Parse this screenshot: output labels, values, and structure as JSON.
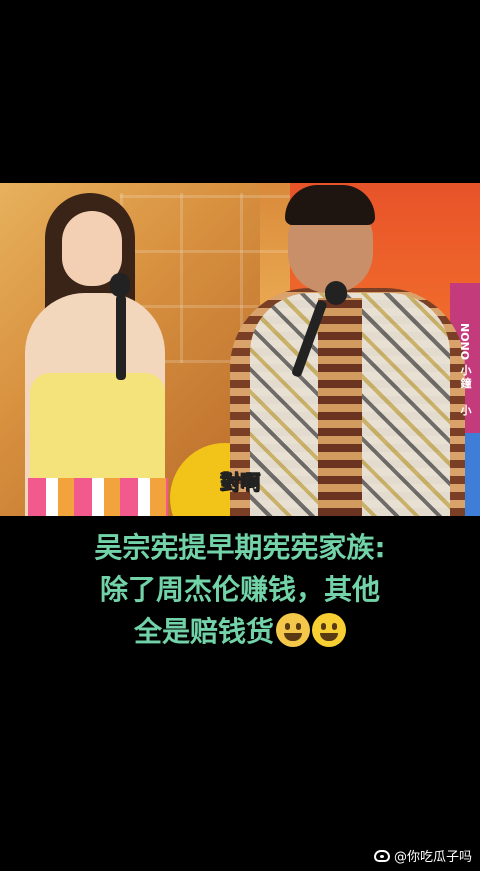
{
  "video": {
    "subtitle": "對啊",
    "side_logo_text": "NONO",
    "side_label_1": "小鐘",
    "side_label_2": "小"
  },
  "caption": {
    "line1": "吴宗宪提早期宪宪家族:",
    "line2": "除了周杰伦赚钱，其他",
    "line3": "全是赔钱货"
  },
  "emojis": [
    "crying-laughing-cat-icon",
    "grinning-face-icon"
  ],
  "watermark": {
    "text": "@你吃瓜子吗",
    "icon": "weibo-icon"
  }
}
